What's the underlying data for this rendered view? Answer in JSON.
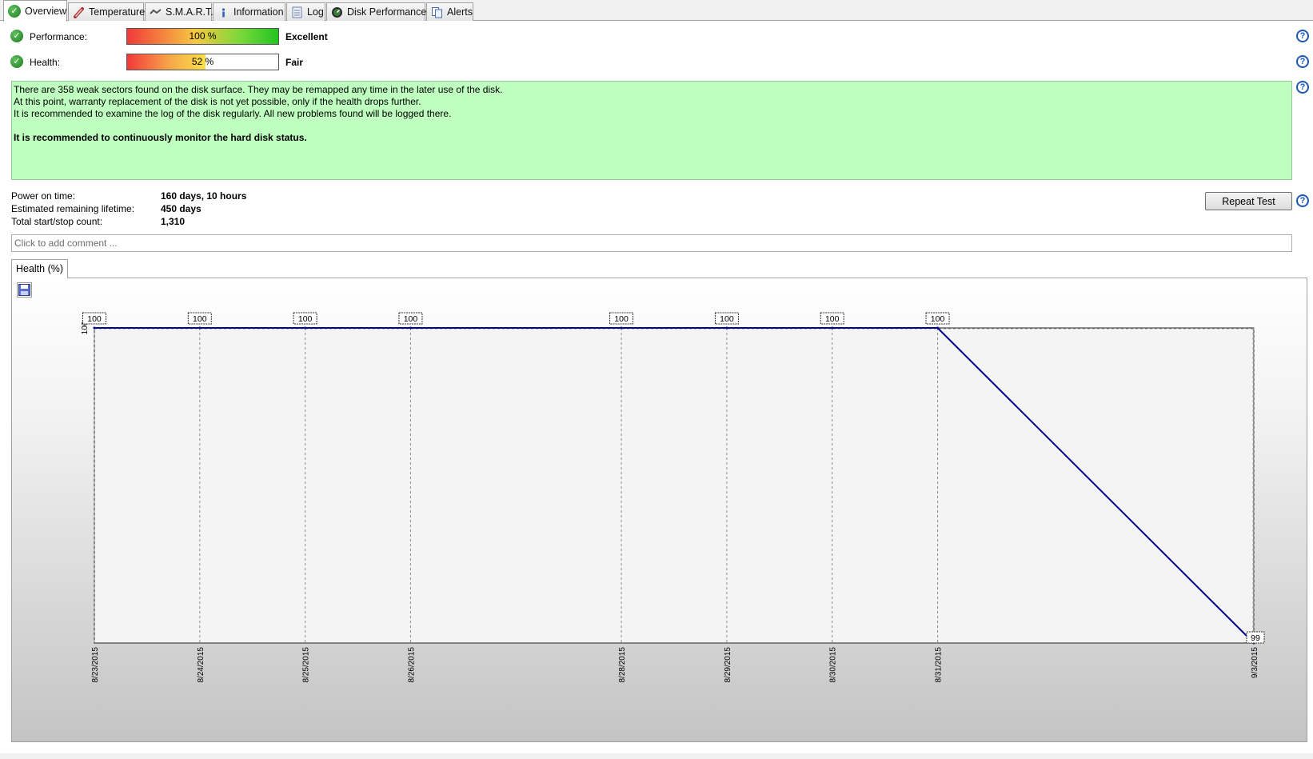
{
  "tabs": [
    {
      "label": "Overview",
      "icon": "check-circle-icon",
      "active": true
    },
    {
      "label": "Temperature",
      "icon": "thermometer-icon"
    },
    {
      "label": "S.M.A.R.T.",
      "icon": "smart-icon"
    },
    {
      "label": "Information",
      "icon": "info-icon"
    },
    {
      "label": "Log",
      "icon": "log-icon"
    },
    {
      "label": "Disk Performance",
      "icon": "gauge-icon"
    },
    {
      "label": "Alerts",
      "icon": "alerts-icon"
    }
  ],
  "performance": {
    "label": "Performance:",
    "value_text": "100 %",
    "percent": 100,
    "rating": "Excellent"
  },
  "health": {
    "label": "Health:",
    "value_text": "52 %",
    "percent": 52,
    "rating": "Fair"
  },
  "message": {
    "lines": [
      "There are 358 weak sectors found on the disk surface. They may be remapped any time in the later use of the disk.",
      "At this point, warranty replacement of the disk is not yet possible, only if the health drops further.",
      "It is recommended to examine the log of the disk regularly. All new problems found will be logged there."
    ],
    "bold_line": "It is recommended to continuously monitor the hard disk status.",
    "background": "#bfffbf"
  },
  "info": {
    "power_on_label": "Power on time:",
    "power_on_value": "160 days, 10 hours",
    "lifetime_label": "Estimated remaining lifetime:",
    "lifetime_value": "450 days",
    "startstop_label": "Total start/stop count:",
    "startstop_value": "1,310"
  },
  "repeat_button": "Repeat Test",
  "comment_placeholder": "Click to add comment ...",
  "chart_tab": "Health (%)",
  "help_symbol": "?",
  "colors": {
    "line": "#00008b",
    "accent_help": "#1c58b5"
  },
  "chart_data": {
    "type": "line",
    "series": [
      {
        "x": [
          "8/23/2015",
          "8/24/2015",
          "8/25/2015",
          "8/26/2015",
          "8/28/2015",
          "8/29/2015",
          "8/30/2015",
          "8/31/2015",
          "9/3/2015"
        ],
        "values": [
          100,
          100,
          100,
          100,
          100,
          100,
          100,
          100,
          99
        ],
        "labels": [
          "100",
          "100",
          "100",
          "100",
          "100",
          "100",
          "100",
          "100",
          "99"
        ]
      }
    ],
    "y_tick_labels": [
      "100"
    ],
    "ylim": [
      99,
      100
    ],
    "grid": true
  }
}
